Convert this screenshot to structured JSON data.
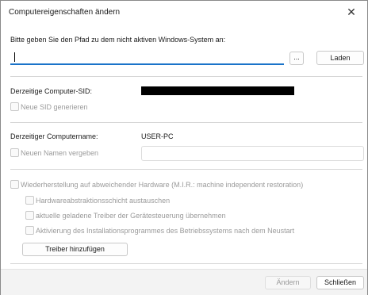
{
  "window": {
    "title": "Computereigenschaften ändern",
    "close_glyph": "✕"
  },
  "path_section": {
    "prompt": "Bitte geben Sie den Pfad zu dem nicht aktiven Windows-System an:",
    "input_value": "",
    "browse_label": "...",
    "load_label": "Laden"
  },
  "sid_section": {
    "label": "Derzeitige Computer-SID:",
    "value_redacted": true,
    "new_sid_checkbox": {
      "label": "Neue SID generieren",
      "checked": false,
      "enabled": false
    }
  },
  "name_section": {
    "label": "Derzeitiger Computername:",
    "value": "USER-PC",
    "new_name_checkbox": {
      "label": "Neuen Namen vergeben",
      "checked": false,
      "enabled": false
    },
    "new_name_value": ""
  },
  "mir_section": {
    "main_checkbox": {
      "label": "Wiederherstellung auf abweichender Hardware (M.I.R.: machine independent restoration)",
      "checked": false,
      "enabled": false
    },
    "options": [
      {
        "label": "Hardwareabstraktionsschicht austauschen",
        "checked": false
      },
      {
        "label": "aktuelle geladene Treiber der Gerätesteuerung übernehmen",
        "checked": false
      },
      {
        "label": "Aktivierung des Installationsprogrammes des Betriebssystems nach dem Neustart",
        "checked": false
      }
    ],
    "add_driver_label": "Treiber hinzufügen"
  },
  "footer": {
    "apply_label": "Ändern",
    "close_label": "Schließen"
  },
  "colors": {
    "focus_underline": "#1a73c9",
    "disabled_text": "#9a9a9a",
    "footer_bg": "#f3f3f3"
  }
}
